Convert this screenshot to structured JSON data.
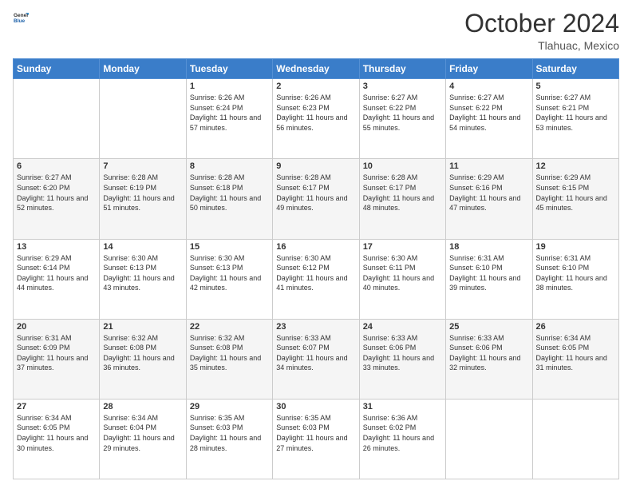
{
  "header": {
    "logo_line1": "General",
    "logo_line2": "Blue",
    "month": "October 2024",
    "location": "Tlahuac, Mexico"
  },
  "days_of_week": [
    "Sunday",
    "Monday",
    "Tuesday",
    "Wednesday",
    "Thursday",
    "Friday",
    "Saturday"
  ],
  "weeks": [
    [
      {
        "day": "",
        "sunrise": "",
        "sunset": "",
        "daylight": ""
      },
      {
        "day": "",
        "sunrise": "",
        "sunset": "",
        "daylight": ""
      },
      {
        "day": "1",
        "sunrise": "Sunrise: 6:26 AM",
        "sunset": "Sunset: 6:24 PM",
        "daylight": "Daylight: 11 hours and 57 minutes."
      },
      {
        "day": "2",
        "sunrise": "Sunrise: 6:26 AM",
        "sunset": "Sunset: 6:23 PM",
        "daylight": "Daylight: 11 hours and 56 minutes."
      },
      {
        "day": "3",
        "sunrise": "Sunrise: 6:27 AM",
        "sunset": "Sunset: 6:22 PM",
        "daylight": "Daylight: 11 hours and 55 minutes."
      },
      {
        "day": "4",
        "sunrise": "Sunrise: 6:27 AM",
        "sunset": "Sunset: 6:22 PM",
        "daylight": "Daylight: 11 hours and 54 minutes."
      },
      {
        "day": "5",
        "sunrise": "Sunrise: 6:27 AM",
        "sunset": "Sunset: 6:21 PM",
        "daylight": "Daylight: 11 hours and 53 minutes."
      }
    ],
    [
      {
        "day": "6",
        "sunrise": "Sunrise: 6:27 AM",
        "sunset": "Sunset: 6:20 PM",
        "daylight": "Daylight: 11 hours and 52 minutes."
      },
      {
        "day": "7",
        "sunrise": "Sunrise: 6:28 AM",
        "sunset": "Sunset: 6:19 PM",
        "daylight": "Daylight: 11 hours and 51 minutes."
      },
      {
        "day": "8",
        "sunrise": "Sunrise: 6:28 AM",
        "sunset": "Sunset: 6:18 PM",
        "daylight": "Daylight: 11 hours and 50 minutes."
      },
      {
        "day": "9",
        "sunrise": "Sunrise: 6:28 AM",
        "sunset": "Sunset: 6:17 PM",
        "daylight": "Daylight: 11 hours and 49 minutes."
      },
      {
        "day": "10",
        "sunrise": "Sunrise: 6:28 AM",
        "sunset": "Sunset: 6:17 PM",
        "daylight": "Daylight: 11 hours and 48 minutes."
      },
      {
        "day": "11",
        "sunrise": "Sunrise: 6:29 AM",
        "sunset": "Sunset: 6:16 PM",
        "daylight": "Daylight: 11 hours and 47 minutes."
      },
      {
        "day": "12",
        "sunrise": "Sunrise: 6:29 AM",
        "sunset": "Sunset: 6:15 PM",
        "daylight": "Daylight: 11 hours and 45 minutes."
      }
    ],
    [
      {
        "day": "13",
        "sunrise": "Sunrise: 6:29 AM",
        "sunset": "Sunset: 6:14 PM",
        "daylight": "Daylight: 11 hours and 44 minutes."
      },
      {
        "day": "14",
        "sunrise": "Sunrise: 6:30 AM",
        "sunset": "Sunset: 6:13 PM",
        "daylight": "Daylight: 11 hours and 43 minutes."
      },
      {
        "day": "15",
        "sunrise": "Sunrise: 6:30 AM",
        "sunset": "Sunset: 6:13 PM",
        "daylight": "Daylight: 11 hours and 42 minutes."
      },
      {
        "day": "16",
        "sunrise": "Sunrise: 6:30 AM",
        "sunset": "Sunset: 6:12 PM",
        "daylight": "Daylight: 11 hours and 41 minutes."
      },
      {
        "day": "17",
        "sunrise": "Sunrise: 6:30 AM",
        "sunset": "Sunset: 6:11 PM",
        "daylight": "Daylight: 11 hours and 40 minutes."
      },
      {
        "day": "18",
        "sunrise": "Sunrise: 6:31 AM",
        "sunset": "Sunset: 6:10 PM",
        "daylight": "Daylight: 11 hours and 39 minutes."
      },
      {
        "day": "19",
        "sunrise": "Sunrise: 6:31 AM",
        "sunset": "Sunset: 6:10 PM",
        "daylight": "Daylight: 11 hours and 38 minutes."
      }
    ],
    [
      {
        "day": "20",
        "sunrise": "Sunrise: 6:31 AM",
        "sunset": "Sunset: 6:09 PM",
        "daylight": "Daylight: 11 hours and 37 minutes."
      },
      {
        "day": "21",
        "sunrise": "Sunrise: 6:32 AM",
        "sunset": "Sunset: 6:08 PM",
        "daylight": "Daylight: 11 hours and 36 minutes."
      },
      {
        "day": "22",
        "sunrise": "Sunrise: 6:32 AM",
        "sunset": "Sunset: 6:08 PM",
        "daylight": "Daylight: 11 hours and 35 minutes."
      },
      {
        "day": "23",
        "sunrise": "Sunrise: 6:33 AM",
        "sunset": "Sunset: 6:07 PM",
        "daylight": "Daylight: 11 hours and 34 minutes."
      },
      {
        "day": "24",
        "sunrise": "Sunrise: 6:33 AM",
        "sunset": "Sunset: 6:06 PM",
        "daylight": "Daylight: 11 hours and 33 minutes."
      },
      {
        "day": "25",
        "sunrise": "Sunrise: 6:33 AM",
        "sunset": "Sunset: 6:06 PM",
        "daylight": "Daylight: 11 hours and 32 minutes."
      },
      {
        "day": "26",
        "sunrise": "Sunrise: 6:34 AM",
        "sunset": "Sunset: 6:05 PM",
        "daylight": "Daylight: 11 hours and 31 minutes."
      }
    ],
    [
      {
        "day": "27",
        "sunrise": "Sunrise: 6:34 AM",
        "sunset": "Sunset: 6:05 PM",
        "daylight": "Daylight: 11 hours and 30 minutes."
      },
      {
        "day": "28",
        "sunrise": "Sunrise: 6:34 AM",
        "sunset": "Sunset: 6:04 PM",
        "daylight": "Daylight: 11 hours and 29 minutes."
      },
      {
        "day": "29",
        "sunrise": "Sunrise: 6:35 AM",
        "sunset": "Sunset: 6:03 PM",
        "daylight": "Daylight: 11 hours and 28 minutes."
      },
      {
        "day": "30",
        "sunrise": "Sunrise: 6:35 AM",
        "sunset": "Sunset: 6:03 PM",
        "daylight": "Daylight: 11 hours and 27 minutes."
      },
      {
        "day": "31",
        "sunrise": "Sunrise: 6:36 AM",
        "sunset": "Sunset: 6:02 PM",
        "daylight": "Daylight: 11 hours and 26 minutes."
      },
      {
        "day": "",
        "sunrise": "",
        "sunset": "",
        "daylight": ""
      },
      {
        "day": "",
        "sunrise": "",
        "sunset": "",
        "daylight": ""
      }
    ]
  ]
}
